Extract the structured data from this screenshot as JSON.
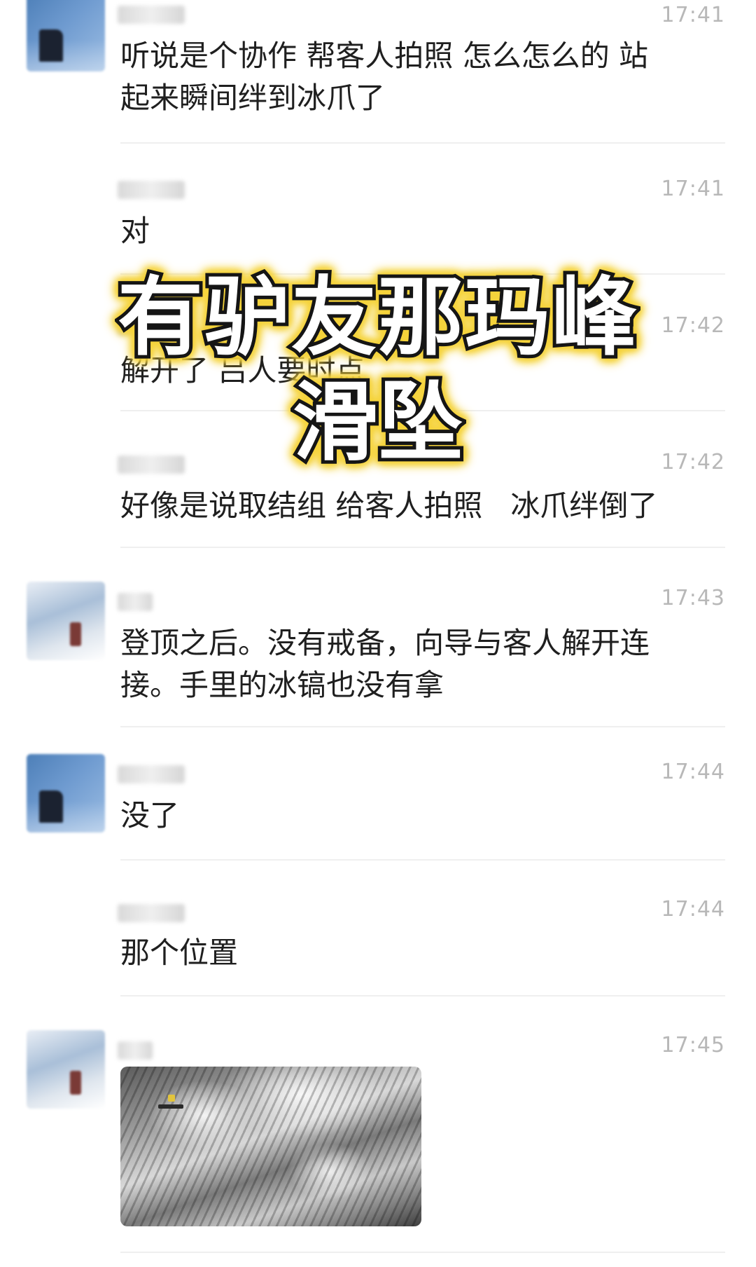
{
  "messages": [
    {
      "time": "17:41",
      "text": "听说是个协作 帮客人拍照 怎么怎么的 站\n起来瞬间绊到冰爪了",
      "avatar": "blue-sky-avatar"
    },
    {
      "time": "17:41",
      "text": "对"
    },
    {
      "time": "17:42",
      "text": "解开了 吕人要时点"
    },
    {
      "time": "17:42",
      "text": "好像是说取结组 给客人拍照   冰爪绊倒了"
    },
    {
      "time": "17:43",
      "text": "登顶之后。没有戒备，向导与客人解开连\n接。手里的冰镐也没有拿",
      "avatar": "snow-mountain-avatar"
    },
    {
      "time": "17:44",
      "text": "没了",
      "avatar": "blue-sky-avatar"
    },
    {
      "time": "17:44",
      "text": "那个位置"
    },
    {
      "time": "17:45",
      "image": "mountain-photo",
      "avatar": "snow-mountain-avatar"
    }
  ],
  "overlay": {
    "line1": "有驴友那玛峰",
    "line2": "滑坠",
    "stroke_color": "#151515",
    "glow_color": "#f5d33b"
  }
}
